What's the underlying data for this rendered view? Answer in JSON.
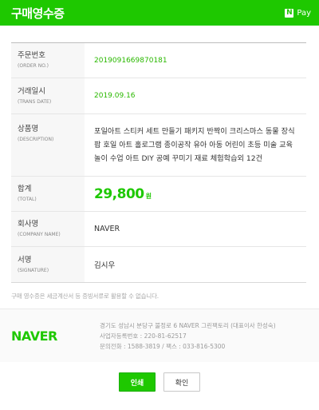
{
  "header": {
    "title": "구매영수증",
    "pay_badge": "N",
    "pay_label": "Pay"
  },
  "receipt": {
    "order_no": {
      "label": "주문번호",
      "sublabel": "(ORDER NO.)",
      "value": "2019091669870181"
    },
    "trans_date": {
      "label": "거래일시",
      "sublabel": "(TRANS DATE)",
      "value": "2019.09.16"
    },
    "description": {
      "label": "상품명",
      "sublabel": "(DESCRIPTION)",
      "value": "포일아트 스티커 세트 만들기 패키지 반짝이 크리스마스 동물 장식 팝 호일 아트 홀로그램 종이공작 유아 아동 어린이 초등 미술 교육 놀이 수업 아트 DIY 공예 꾸미기 재료 체험학습외 12건"
    },
    "total": {
      "label": "합계",
      "sublabel": "(TOTAL)",
      "amount": "29,800",
      "unit": "원"
    },
    "company": {
      "label": "회사명",
      "sublabel": "(COMPANY NAME)",
      "value": "NAVER"
    },
    "signature": {
      "label": "서명",
      "sublabel": "(SIGNATURE)",
      "value": "김시우"
    }
  },
  "note": "구매 영수증은 세금계산서 등 증빙서류로 활용할 수 없습니다.",
  "footer": {
    "logo": "NAVER",
    "address": "경기도 성남시 분당구 불정로 6 NAVER 그린팩토리 (대표이사 한성숙)",
    "business_no": "사업자등록번호 : 220-81-62517",
    "contact": "문의전화 : 1588-3819 / 팩스 : 033-816-5300"
  },
  "buttons": {
    "print": "인쇄",
    "ok": "확인"
  },
  "colors": {
    "brand_green": "#1ec800",
    "value_green": "#2ab800"
  }
}
